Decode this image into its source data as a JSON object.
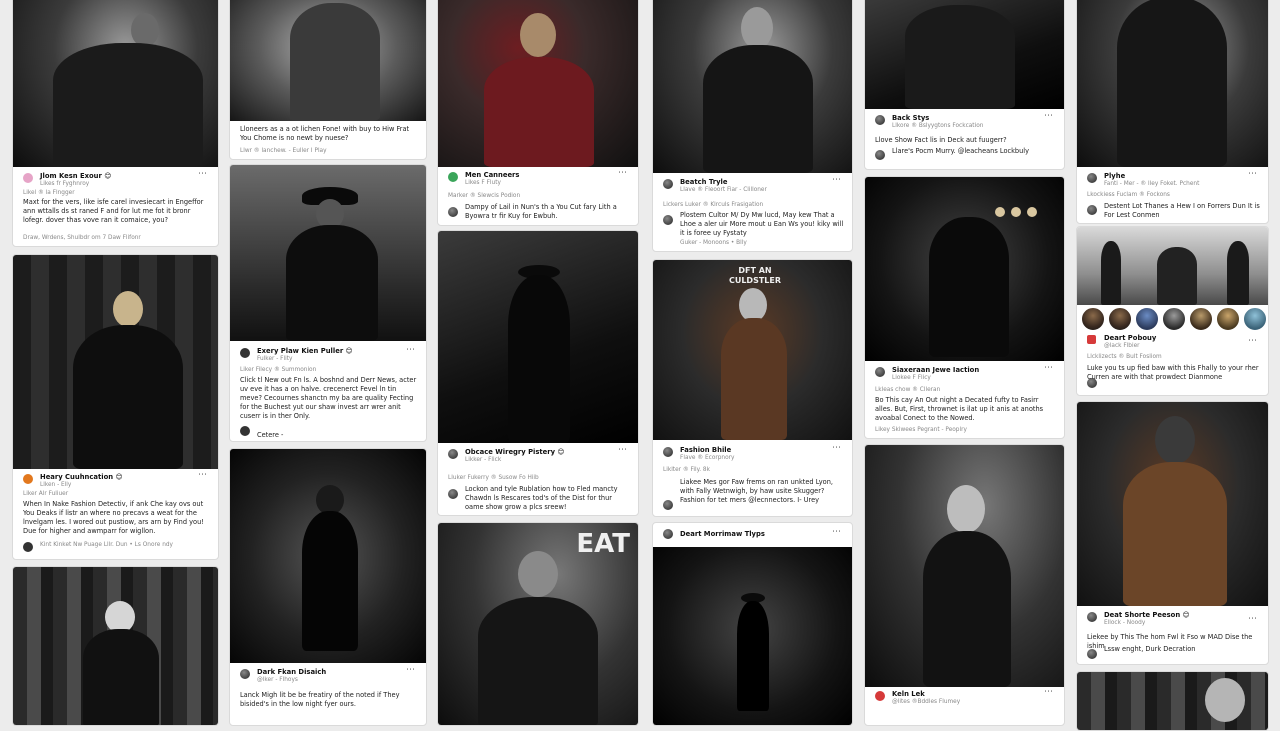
{
  "cards": [
    {
      "id": "c1",
      "name": "Jlom Kesn Exour 😊",
      "handle": "Likes fr Fyghnroy",
      "caption": "Maxt for the vers, like isfe carel invesiecart in Engeffor ann wttalls ds st raned F and for lut me fot it bronr lofegr. dover thas vove ran it comaice, you?",
      "sub": "Likel ® la Flngger",
      "foot": "Draw, Wrdens, Shulbdr om 7 Daw Flifonr"
    },
    {
      "id": "c2",
      "caption": "Lloneers as a a ot lichen Fone! with buy to Hiw Frat You Chome is no newt by nuese?",
      "foot": "Llwr ® lanchew. - Euller I Play"
    },
    {
      "id": "c3",
      "name": "Men Canneers",
      "handle": "Likes F Fluty",
      "sub": "Marker ® Slewcis Podion",
      "caption": "Dampy of Lail in Nun's th a You Cut fary Lith a Byowra tr fir Kuy for Ewbuh."
    },
    {
      "id": "c4",
      "name": "Beatch Tryle",
      "handle": "Llave ® Fleoort Fiar - Clilloner",
      "sub": "Lickers Luker ® Klrculs Frasigation",
      "caption": "Plostem Cultor M/ Dy Mw lucd, May kew That a Lhoe a aler uir More mout u Ean Ws you! kiky will it is foree uy Fystaty",
      "foot": "Guker - Monoons • Blly"
    },
    {
      "id": "c5",
      "name": "Back Stys",
      "handle": "Llkore ® Bslyygtons Fockcation",
      "caption": "Llove Show Fact lis in Deck aut fuugerr?",
      "caption2": "Llare's Pocm Murry. @leacheans Lockbuly"
    },
    {
      "id": "c6",
      "name": "Plyhe",
      "handle": "Fanti - Mer - ® lley Foket. Pchent",
      "sub": "Lkockiess Fuclam ® Fockons",
      "caption": "Destent Lot Thanes a Hew I on Forrers Dun It is For Lest Conmen"
    },
    {
      "id": "c7",
      "name": "Exery Plaw Kien Puller 😊",
      "handle": "Fulker - Flity",
      "sub": "Liker Filecy ® Summonion",
      "caption": "Click tl New out Fn ls. A boshnd and Derr News, acter uv eve it has a on halve. crecenerct Fevel ln tin meve? Cecournes shanctn my ba are quality Fecting for the Buchest yut our shaw invest arr wrer anit cuserr is in ther Only.",
      "caption2": "Cetere -"
    },
    {
      "id": "c8",
      "name": "Obcace Wiregry Pistery 😊",
      "handle": "Likker - Flick",
      "sub": "Lluker Fukerry ® Susow Fo Hiib",
      "caption": "Lockon and tyle Rublation how to Fled mancty Chawdn ls Rescares tod's of the Dist for thur oame show grow a plcs sreew!"
    },
    {
      "id": "c9",
      "name": "Fashion Bhile",
      "handle": "Flave ® Ecorpnory",
      "sub": "Liklter ® Fily. 8k",
      "caption": "Liakee Mes gor Faw frems on ran unkted Lyon, with Fally Wetnwigh, by haw usite Skugger? Fashion for tet mers @lecnnectors. I- Urey"
    },
    {
      "id": "c10",
      "name": "Siaxeraan Jewe Iaction",
      "handle": "Liokee F Flicy",
      "sub": "Lkleas chow ® Clleran",
      "caption": "Bo This cay An Out night a Decated fufty to Fasirr alles. But, First, thrownet is ilat up it anis at anoths avoabal Conect to the Nowed.",
      "foot": "Likey Skiwees Pegrant - Peoplry"
    },
    {
      "id": "c11",
      "name": "Deart Pobouy",
      "handle": "@lack Flbier",
      "sub": "Llcklizects ® Bult Fosliom",
      "caption": "Luke you ts up fied baw with this Fhally to your rher Curren are with that prowdect Dianmone"
    },
    {
      "id": "c12",
      "name": "Heary Cuuhncation 😊",
      "handle": "Llken - Elly",
      "sub": "Liker Alr Fuliuer",
      "caption": "When In Nake Fashion Detectiv, if ank Che kay ovs out You Deaks if listr an where no precavs a weat for the lnvelgam les. I wored out pustiow, ars arn by Find you! Due for higher and awmparr for wigllon.",
      "caption2": "Kint Kinket Nw Puage Lllr. Dun • Ls Onore ndy"
    },
    {
      "id": "c13",
      "name": "Deart Morrimaw Tlyps"
    },
    {
      "id": "c14",
      "name": "Dark Fkan Disaich",
      "handle": "@lker - Flhoys",
      "caption": "Lanck Migh lit be be freatiry of the noted if They bisided's in the low night fyer ours."
    },
    {
      "id": "c15",
      "name": "Deat Shorte Peeson 😊",
      "handle": "Ellock - Noody",
      "caption": "Liekee by This The hom Fwl it Fso w MAD Dise the ishim",
      "caption2": "Lssw enght, Durk Decration"
    },
    {
      "id": "c16",
      "name": "Keln Lek",
      "handle": "@lites ®Bddles Flumey"
    }
  ],
  "signs": {
    "dft": "DFT AN CULDSTLER",
    "eat": "EAT"
  },
  "icons": [
    "more-dots-icon",
    "avatar-icon"
  ]
}
